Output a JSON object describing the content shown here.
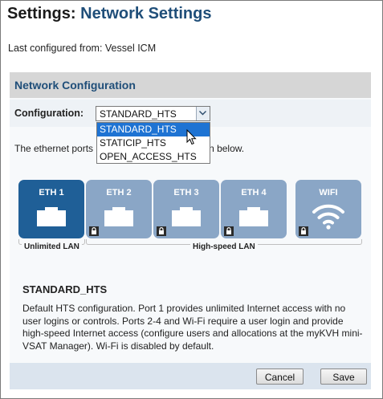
{
  "title": {
    "main": "Settings:",
    "sub": "Network Settings"
  },
  "last_configured": "Last configured from: Vessel ICM",
  "section_title": "Network Configuration",
  "configuration": {
    "label": "Configuration:",
    "selected": "STANDARD_HTS",
    "options": [
      "STANDARD_HTS",
      "STATICIP_HTS",
      "OPEN_ACCESS_HTS"
    ],
    "highlighted_option_index": 0
  },
  "ports_description": {
    "before": "The ethernet ports",
    "after": "n below."
  },
  "ports": [
    {
      "label": "ETH 1",
      "icon": "ethernet-jack-icon",
      "locked": false,
      "active": true
    },
    {
      "label": "ETH 2",
      "icon": "ethernet-jack-icon",
      "locked": true,
      "active": false
    },
    {
      "label": "ETH 3",
      "icon": "ethernet-jack-icon",
      "locked": true,
      "active": false
    },
    {
      "label": "ETH 4",
      "icon": "ethernet-jack-icon",
      "locked": true,
      "active": false
    },
    {
      "label": "WIFI",
      "icon": "wifi-icon",
      "locked": true,
      "active": false
    }
  ],
  "groups": {
    "unlimited": "Unlimited LAN",
    "high_speed": "High-speed LAN"
  },
  "selected_config": {
    "name": "STANDARD_HTS",
    "description": "Default HTS configuration. Port 1 provides unlimited Internet access with no user logins or controls. Ports 2-4 and Wi-Fi require a user login and provide high-speed Internet access (configure users and allocations at the myKVH mini-VSAT Manager). Wi-Fi is disabled by default."
  },
  "buttons": {
    "cancel": "Cancel",
    "save": "Save"
  },
  "colors": {
    "title_blue": "#1f4e79",
    "port_active": "#1f5f97",
    "port_inactive": "#8aa6c6",
    "dropdown_highlight": "#1e73d3"
  }
}
